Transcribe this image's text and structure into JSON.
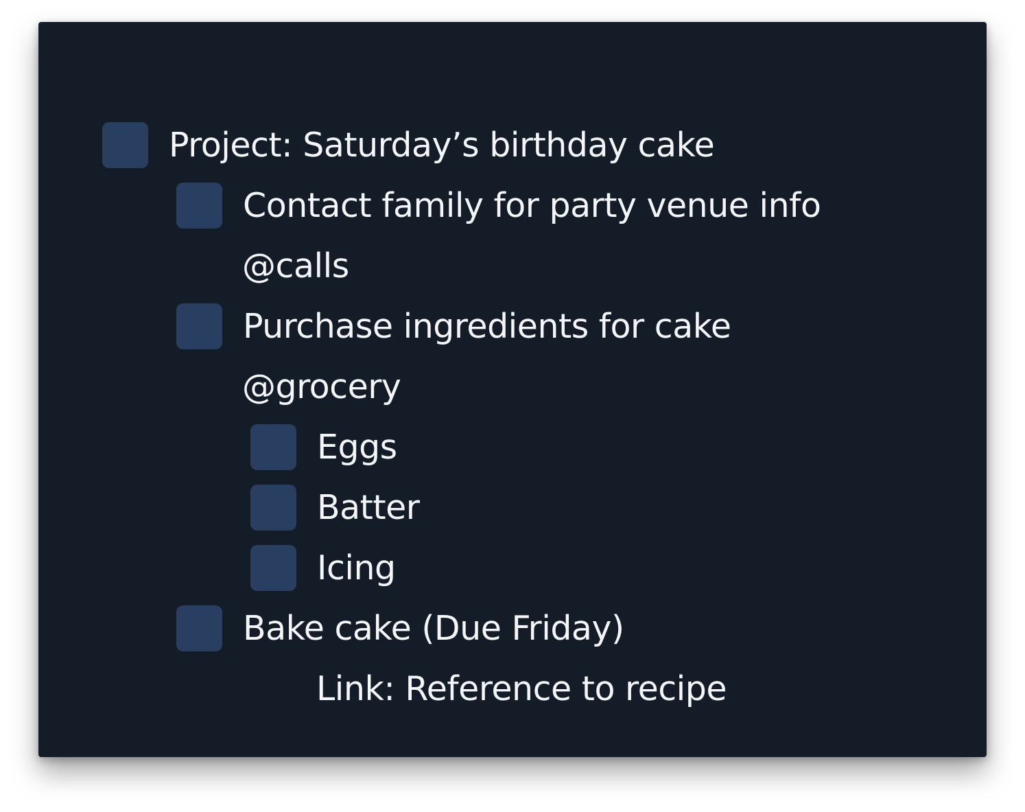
{
  "colors": {
    "background": "#131c27",
    "checkbox": "#293f62",
    "text": "#f4f6f8"
  },
  "outline": {
    "project": "Project: Saturday’s birthday cake",
    "task_contact": "Contact family for party venue info",
    "tag_calls": "@calls",
    "task_purchase": "Purchase ingredients for cake",
    "tag_grocery": "@grocery",
    "item_eggs": "Eggs",
    "item_batter": "Batter",
    "item_icing": "Icing",
    "task_bake": "Bake cake (Due Friday)",
    "link_recipe": "Link: Reference to recipe"
  }
}
